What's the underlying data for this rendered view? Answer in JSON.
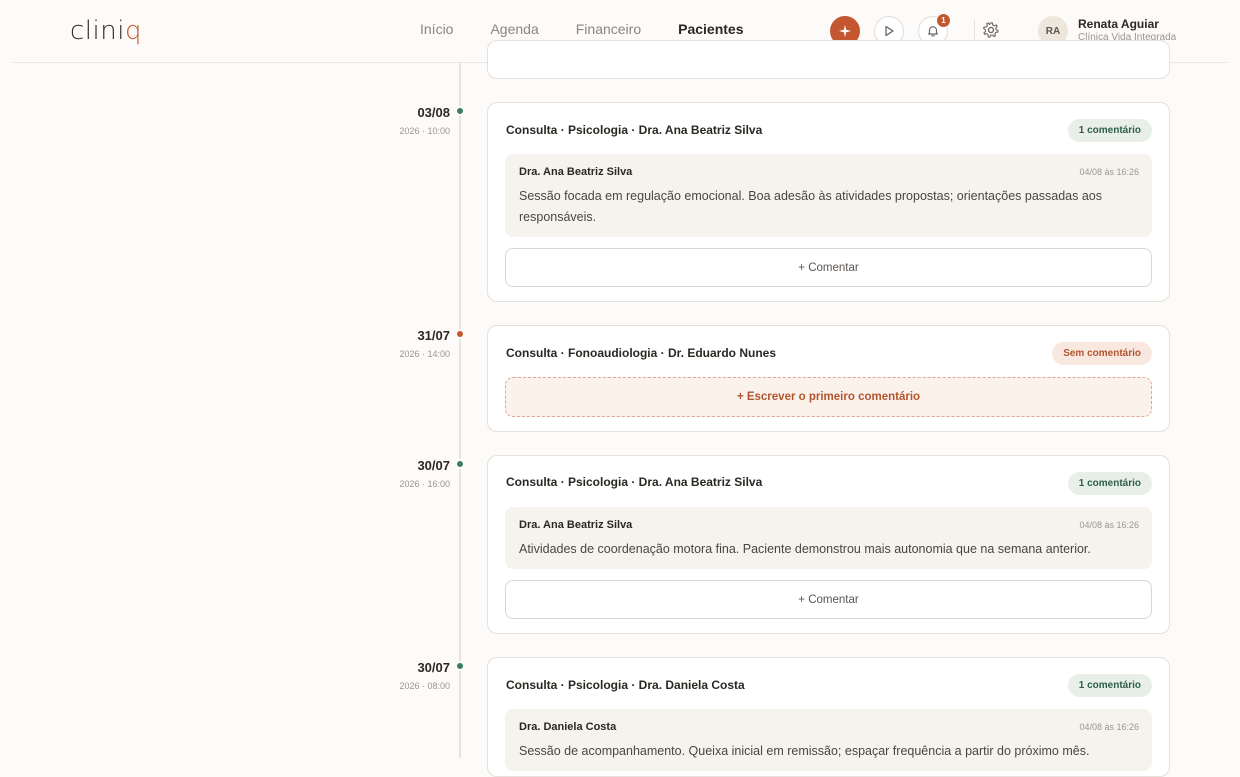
{
  "app": {
    "logo_main": "clini",
    "logo_accent": "q"
  },
  "nav": {
    "items": [
      {
        "label": "Início"
      },
      {
        "label": "Agenda"
      },
      {
        "label": "Financeiro"
      },
      {
        "label": "Pacientes",
        "active": true
      }
    ]
  },
  "header": {
    "actions": {
      "primary_icon": "sparkle-icon",
      "play_icon": "play-icon",
      "bell_icon": "bell-icon",
      "notification_count": "1",
      "settings_icon": "gear-icon"
    },
    "user": {
      "initials": "RA",
      "name": "Renata Aguiar",
      "clinic": "Clínica Vida Integrada"
    }
  },
  "colors": {
    "accent": "#c4572f",
    "success": "#3b7d60",
    "background": "#fcfbf9"
  },
  "timeline": [
    {
      "date": "03/08",
      "sub": "2026 · 10:00",
      "status": "green",
      "title": "Consulta · Psicologia · Dra. Ana Beatriz Silva",
      "badge": "1 comentário",
      "comment": {
        "author": "Dra. Ana Beatriz Silva",
        "time": "04/08 às 16:26",
        "text": "Sessão focada em regulação emocional. Boa adesão às atividades propostas; orientações passadas aos responsáveis."
      },
      "action": "+ Comentar"
    },
    {
      "date": "31/07",
      "sub": "2026 · 14:00",
      "status": "orange",
      "title": "Consulta · Fonoaudiologia · Dr. Eduardo Nunes",
      "badge": "Sem comentário",
      "action": "+ Escrever o primeiro comentário"
    },
    {
      "date": "30/07",
      "sub": "2026 · 16:00",
      "status": "green",
      "title": "Consulta · Psicologia · Dra. Ana Beatriz Silva",
      "badge": "1 comentário",
      "comment": {
        "author": "Dra. Ana Beatriz Silva",
        "time": "04/08 às 16:26",
        "text": "Atividades de coordenação motora fina. Paciente demonstrou mais autonomia que na semana anterior."
      },
      "action": "+ Comentar"
    },
    {
      "date": "30/07",
      "sub": "2026 · 08:00",
      "status": "green",
      "title": "Consulta · Psicologia · Dra. Daniela Costa",
      "badge": "1 comentário",
      "comment": {
        "author": "Dra. Daniela Costa",
        "time": "04/08 às 16:26",
        "text": "Sessão de acompanhamento. Queixa inicial em remissão; espaçar frequência a partir do próximo mês."
      }
    }
  ]
}
